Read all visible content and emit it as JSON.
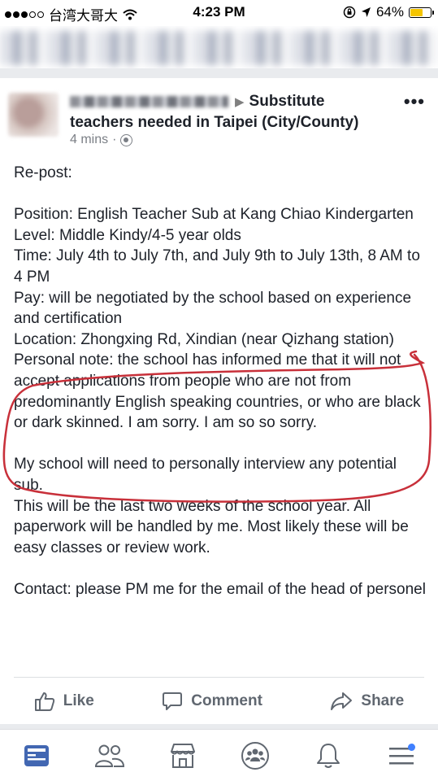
{
  "status_bar": {
    "carrier": "台湾大哥大",
    "time": "4:23 PM",
    "battery": "64%",
    "battery_level": 0.64
  },
  "post": {
    "group_name": "Substitute teachers needed in Taipei (City/County)",
    "timestamp": "4 mins",
    "privacy_separator": "·",
    "body": [
      "Re-post:",
      "",
      "Position: English Teacher Sub at Kang Chiao Kindergarten",
      "Level: Middle Kindy/4-5 year olds",
      "Time: July 4th to July 7th, and July 9th to July 13th, 8 AM to 4 PM",
      "Pay: will be negotiated by the school based on experience and certification",
      "Location: Zhongxing Rd, Xindian (near Qizhang station)",
      "Personal note: the school has informed me that it will not accept applications from people who are not from predominantly English speaking countries, or who are black or dark skinned. I am sorry. I am so so sorry.",
      "",
      "My school will need to personally interview any potential sub.",
      "This will be the last two weeks of the school year. All paperwork will be handled by me. Most likely these will be easy classes or review work.",
      "",
      "Contact: please PM me for the email of the head of personel"
    ],
    "actions": {
      "like": "Like",
      "comment": "Comment",
      "share": "Share"
    }
  },
  "annotation_color": "#c8303a",
  "nav": {
    "items": [
      "news-feed-icon",
      "friends-icon",
      "marketplace-icon",
      "groups-icon",
      "notifications-icon",
      "menu-icon"
    ],
    "active_color": "#4267b2"
  }
}
